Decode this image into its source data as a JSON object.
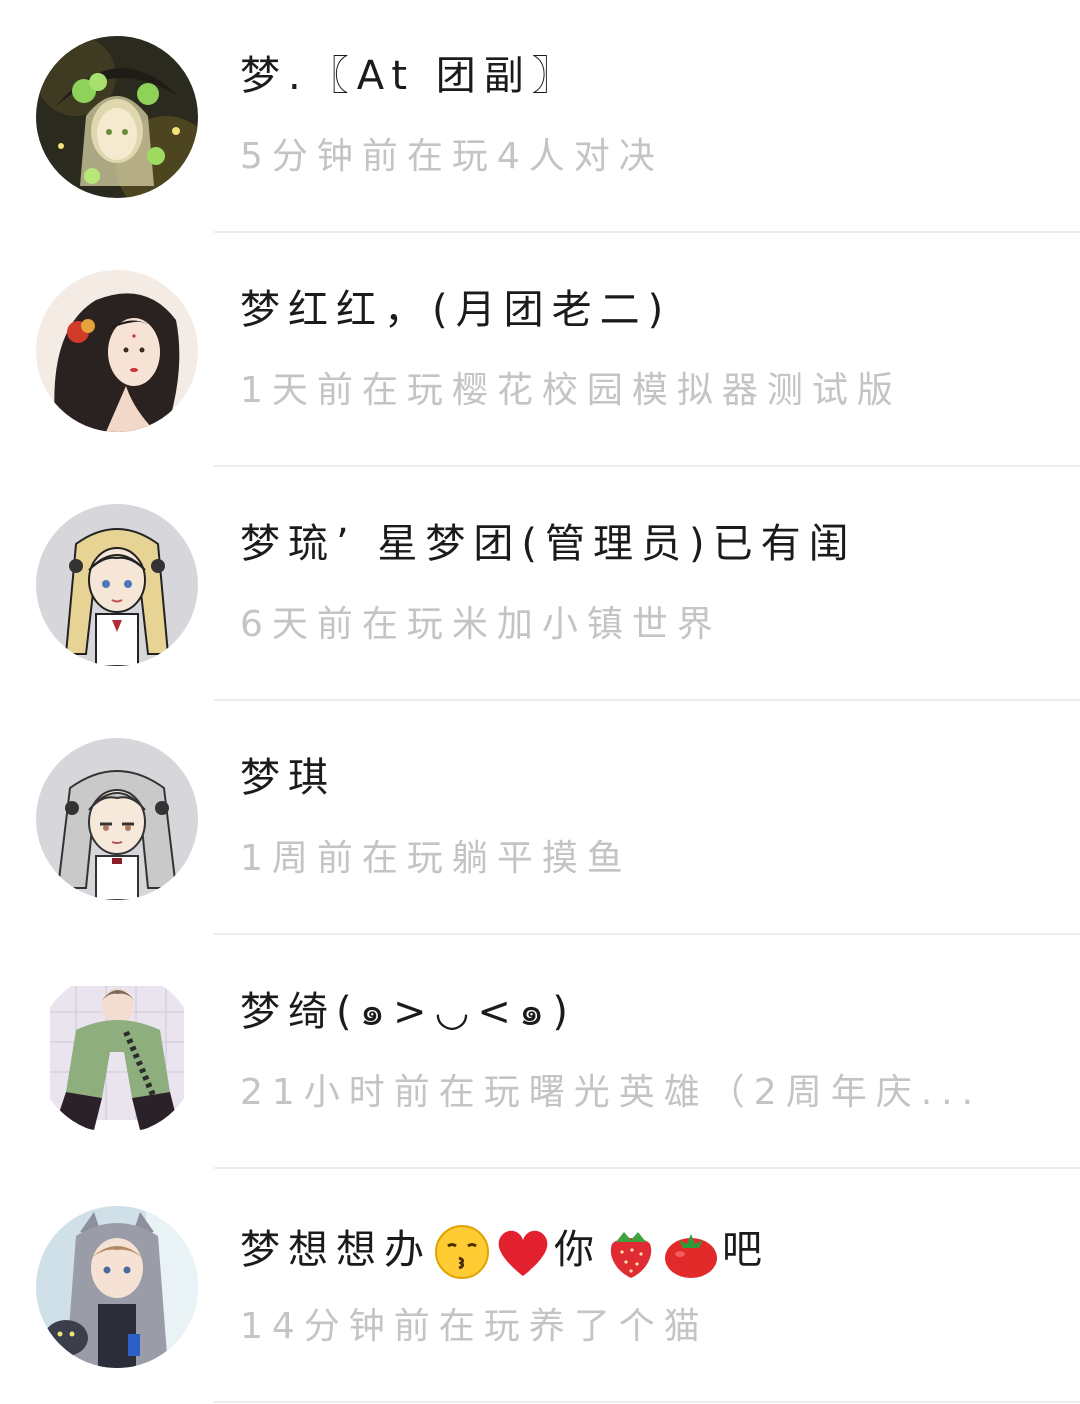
{
  "friends": [
    {
      "name": "梦.〖At 团副〗",
      "status": "5分钟前在玩4人对决",
      "avatar_icon": "anime-girl-green-flowers-avatar"
    },
    {
      "name": "梦红红，(月团老二)",
      "status": "1天前在玩樱花校园模拟器测试版",
      "avatar_icon": "anime-girl-red-flower-hairpin-avatar"
    },
    {
      "name": "梦琉’ 星梦团(管理员)已有闺",
      "status": "6天前在玩米加小镇世界",
      "avatar_icon": "blonde-twin-tails-girl-avatar"
    },
    {
      "name": "梦琪",
      "status": "1周前在玩躺平摸鱼",
      "avatar_icon": "silver-hair-girl-avatar"
    },
    {
      "name": "梦绮(๑>◡<๑)",
      "status": "21小时前在玩曙光英雄（2周年庆...",
      "avatar_icon": "green-hoodie-boy-avatar"
    },
    {
      "name_parts": [
        "梦想想办",
        "你",
        "吧"
      ],
      "emojis": [
        "kissing-face-emoji",
        "red-heart-emoji",
        "strawberry-emoji",
        "tomato-emoji"
      ],
      "status": "14分钟前在玩养了个猫",
      "avatar_icon": "cat-hoodie-boy-avatar"
    }
  ],
  "colors": {
    "name": "#1b1b1b",
    "status": "#c4c4c4",
    "divider": "#ececec",
    "background": "#ffffff"
  }
}
